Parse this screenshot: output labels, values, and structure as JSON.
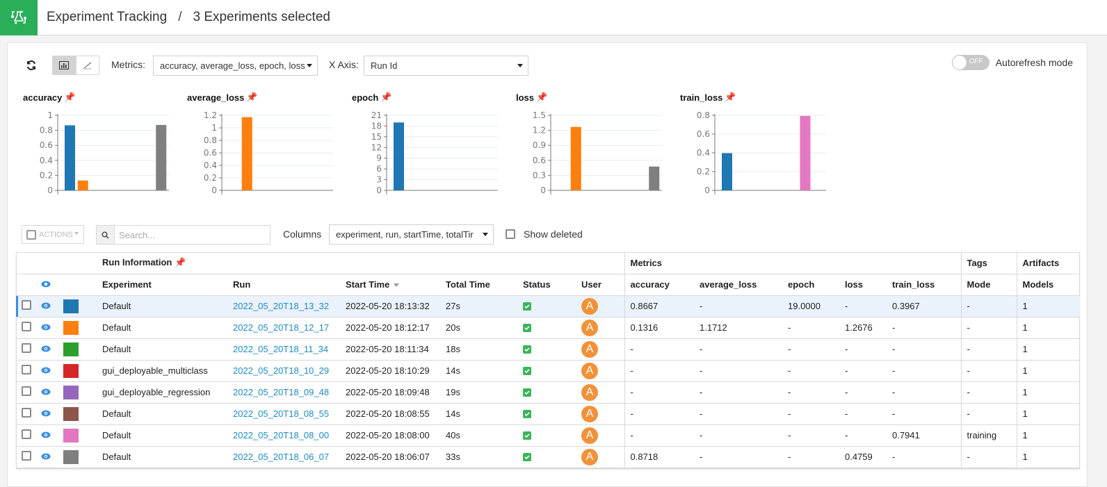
{
  "header": {
    "app_icon": "flask-cycle-icon",
    "breadcrumb_root": "Experiment Tracking",
    "breadcrumb_separator": "/",
    "breadcrumb_current": "3 Experiments selected",
    "brand_color": "#2aae5a"
  },
  "toolbar": {
    "refresh_icon": "refresh-icon",
    "view_modes": [
      {
        "name": "bar-chart-view",
        "active": true
      },
      {
        "name": "line-chart-view",
        "active": false
      }
    ],
    "metrics_label": "Metrics:",
    "metrics_value": "accuracy, average_loss, epoch, loss",
    "xaxis_label": "X Axis:",
    "xaxis_value": "Run Id",
    "autorefresh_toggle": "OFF",
    "autorefresh_label": "Autorefresh mode"
  },
  "chart_data": [
    {
      "type": "bar",
      "title": "accuracy",
      "categories": [
        "2022_05_20T18_13_32",
        "2022_05_20T18_12_17",
        "2022_05_20T18_11_34",
        "2022_05_20T18_10_29",
        "2022_05_20T18_09_48",
        "2022_05_20T18_08_55",
        "2022_05_20T18_08_00",
        "2022_05_20T18_06_07"
      ],
      "values": [
        0.8667,
        0.1316,
        null,
        null,
        null,
        null,
        null,
        0.8718
      ],
      "ylim": [
        0,
        1
      ],
      "yticks": [
        "0",
        "0.2",
        "0.4",
        "0.6",
        "0.8",
        "1"
      ],
      "grid": true
    },
    {
      "type": "bar",
      "title": "average_loss",
      "categories": [
        "2022_05_20T18_13_32",
        "2022_05_20T18_12_17",
        "2022_05_20T18_11_34",
        "2022_05_20T18_10_29",
        "2022_05_20T18_09_48",
        "2022_05_20T18_08_55",
        "2022_05_20T18_08_00",
        "2022_05_20T18_06_07"
      ],
      "values": [
        null,
        1.1712,
        null,
        null,
        null,
        null,
        null,
        null
      ],
      "ylim": [
        0,
        1.2
      ],
      "yticks": [
        "0",
        "0.2",
        "0.4",
        "0.6",
        "0.8",
        "1",
        "1.2"
      ],
      "grid": true
    },
    {
      "type": "bar",
      "title": "epoch",
      "categories": [
        "2022_05_20T18_13_32",
        "2022_05_20T18_12_17",
        "2022_05_20T18_11_34",
        "2022_05_20T18_10_29",
        "2022_05_20T18_09_48",
        "2022_05_20T18_08_55",
        "2022_05_20T18_08_00",
        "2022_05_20T18_06_07"
      ],
      "values": [
        19,
        null,
        null,
        null,
        null,
        null,
        null,
        null
      ],
      "ylim": [
        0,
        21
      ],
      "yticks": [
        "0",
        "3",
        "6",
        "9",
        "12",
        "15",
        "18",
        "21"
      ],
      "grid": true
    },
    {
      "type": "bar",
      "title": "loss",
      "categories": [
        "2022_05_20T18_13_32",
        "2022_05_20T18_12_17",
        "2022_05_20T18_11_34",
        "2022_05_20T18_10_29",
        "2022_05_20T18_09_48",
        "2022_05_20T18_08_55",
        "2022_05_20T18_08_00",
        "2022_05_20T18_06_07"
      ],
      "values": [
        null,
        1.2676,
        null,
        null,
        null,
        null,
        null,
        0.4759
      ],
      "ylim": [
        0,
        1.5
      ],
      "yticks": [
        "0",
        "0.3",
        "0.6",
        "0.9",
        "1.2",
        "1.5"
      ],
      "grid": true
    },
    {
      "type": "bar",
      "title": "train_loss",
      "categories": [
        "2022_05_20T18_13_32",
        "2022_05_20T18_12_17",
        "2022_05_20T18_11_34",
        "2022_05_20T18_10_29",
        "2022_05_20T18_09_48",
        "2022_05_20T18_08_55",
        "2022_05_20T18_08_00",
        "2022_05_20T18_06_07"
      ],
      "values": [
        0.3967,
        null,
        null,
        null,
        null,
        null,
        0.7941,
        null
      ],
      "ylim": [
        0,
        0.8
      ],
      "yticks": [
        "0",
        "0.2",
        "0.4",
        "0.6",
        "0.8"
      ],
      "grid": true
    }
  ],
  "table_toolbar": {
    "actions_label": "ACTIONS",
    "search_placeholder": "Search...",
    "columns_label": "Columns",
    "columns_value": "experiment, run, startTime, totalTir",
    "show_deleted_label": "Show deleted"
  },
  "table": {
    "group_headers": {
      "run_information": "Run Information",
      "metrics": "Metrics",
      "tags": "Tags",
      "artifacts": "Artifacts"
    },
    "columns": [
      "Experiment",
      "Run",
      "Start Time",
      "Total Time",
      "Status",
      "User",
      "accuracy",
      "average_loss",
      "epoch",
      "loss",
      "train_loss",
      "Mode",
      "Models"
    ],
    "rows": [
      {
        "color": "#1f77b4",
        "selected": true,
        "experiment": "Default",
        "run": "2022_05_20T18_13_32",
        "start": "2022-05-20 18:13:32",
        "total": "27s",
        "user": "A",
        "accuracy": "0.8667",
        "average_loss": "-",
        "epoch": "19.0000",
        "loss": "-",
        "train_loss": "0.3967",
        "mode": "-",
        "models": "1"
      },
      {
        "color": "#ff7f0e",
        "selected": false,
        "experiment": "Default",
        "run": "2022_05_20T18_12_17",
        "start": "2022-05-20 18:12:17",
        "total": "20s",
        "user": "A",
        "accuracy": "0.1316",
        "average_loss": "1.1712",
        "epoch": "-",
        "loss": "1.2676",
        "train_loss": "-",
        "mode": "-",
        "models": "1"
      },
      {
        "color": "#2ca02c",
        "selected": false,
        "experiment": "Default",
        "run": "2022_05_20T18_11_34",
        "start": "2022-05-20 18:11:34",
        "total": "18s",
        "user": "A",
        "accuracy": "-",
        "average_loss": "-",
        "epoch": "-",
        "loss": "-",
        "train_loss": "-",
        "mode": "-",
        "models": "1"
      },
      {
        "color": "#d62728",
        "selected": false,
        "experiment": "gui_deployable_multiclass",
        "run": "2022_05_20T18_10_29",
        "start": "2022-05-20 18:10:29",
        "total": "14s",
        "user": "A",
        "accuracy": "-",
        "average_loss": "-",
        "epoch": "-",
        "loss": "-",
        "train_loss": "-",
        "mode": "-",
        "models": "1"
      },
      {
        "color": "#9467bd",
        "selected": false,
        "experiment": "gui_deployable_regression",
        "run": "2022_05_20T18_09_48",
        "start": "2022-05-20 18:09:48",
        "total": "19s",
        "user": "A",
        "accuracy": "-",
        "average_loss": "-",
        "epoch": "-",
        "loss": "-",
        "train_loss": "-",
        "mode": "-",
        "models": "1"
      },
      {
        "color": "#8c564b",
        "selected": false,
        "experiment": "Default",
        "run": "2022_05_20T18_08_55",
        "start": "2022-05-20 18:08:55",
        "total": "14s",
        "user": "A",
        "accuracy": "-",
        "average_loss": "-",
        "epoch": "-",
        "loss": "-",
        "train_loss": "-",
        "mode": "-",
        "models": "1"
      },
      {
        "color": "#e377c2",
        "selected": false,
        "experiment": "Default",
        "run": "2022_05_20T18_08_00",
        "start": "2022-05-20 18:08:00",
        "total": "40s",
        "user": "A",
        "accuracy": "-",
        "average_loss": "-",
        "epoch": "-",
        "loss": "-",
        "train_loss": "0.7941",
        "mode": "training",
        "models": "1"
      },
      {
        "color": "#7f7f7f",
        "selected": false,
        "experiment": "Default",
        "run": "2022_05_20T18_06_07",
        "start": "2022-05-20 18:06:07",
        "total": "33s",
        "user": "A",
        "accuracy": "0.8718",
        "average_loss": "-",
        "epoch": "-",
        "loss": "0.4759",
        "train_loss": "-",
        "mode": "-",
        "models": "1"
      }
    ]
  }
}
